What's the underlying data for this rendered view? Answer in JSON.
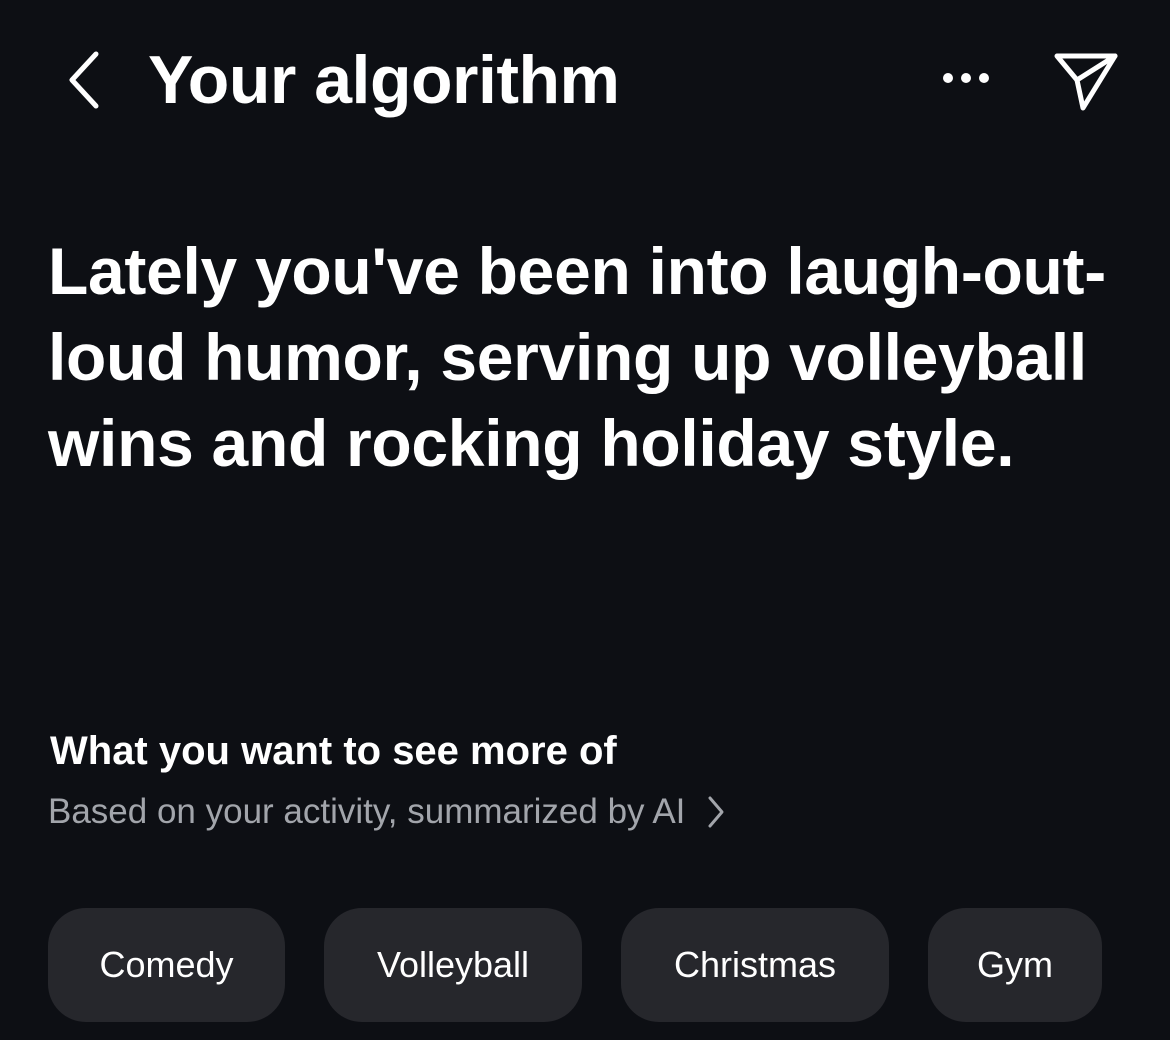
{
  "header": {
    "title": "Your algorithm",
    "back_icon": "chevron-left-icon",
    "more_icon": "ellipsis-icon",
    "share_icon": "paper-plane-icon"
  },
  "summary": {
    "text": "Lately you've been into laugh-out-loud humor, serving up volleyball wins and rocking holiday style."
  },
  "section": {
    "title": "What you want to see more of",
    "subtitle": "Based on your activity, summarized by AI",
    "subtitle_icon": "chevron-right-icon"
  },
  "topics": [
    "Comedy",
    "Volleyball",
    "Christmas",
    "Gym"
  ],
  "colors": {
    "background": "#0d0f14",
    "text": "#ffffff",
    "muted_text": "#a2a5ab",
    "chip_background": "#26272c"
  }
}
